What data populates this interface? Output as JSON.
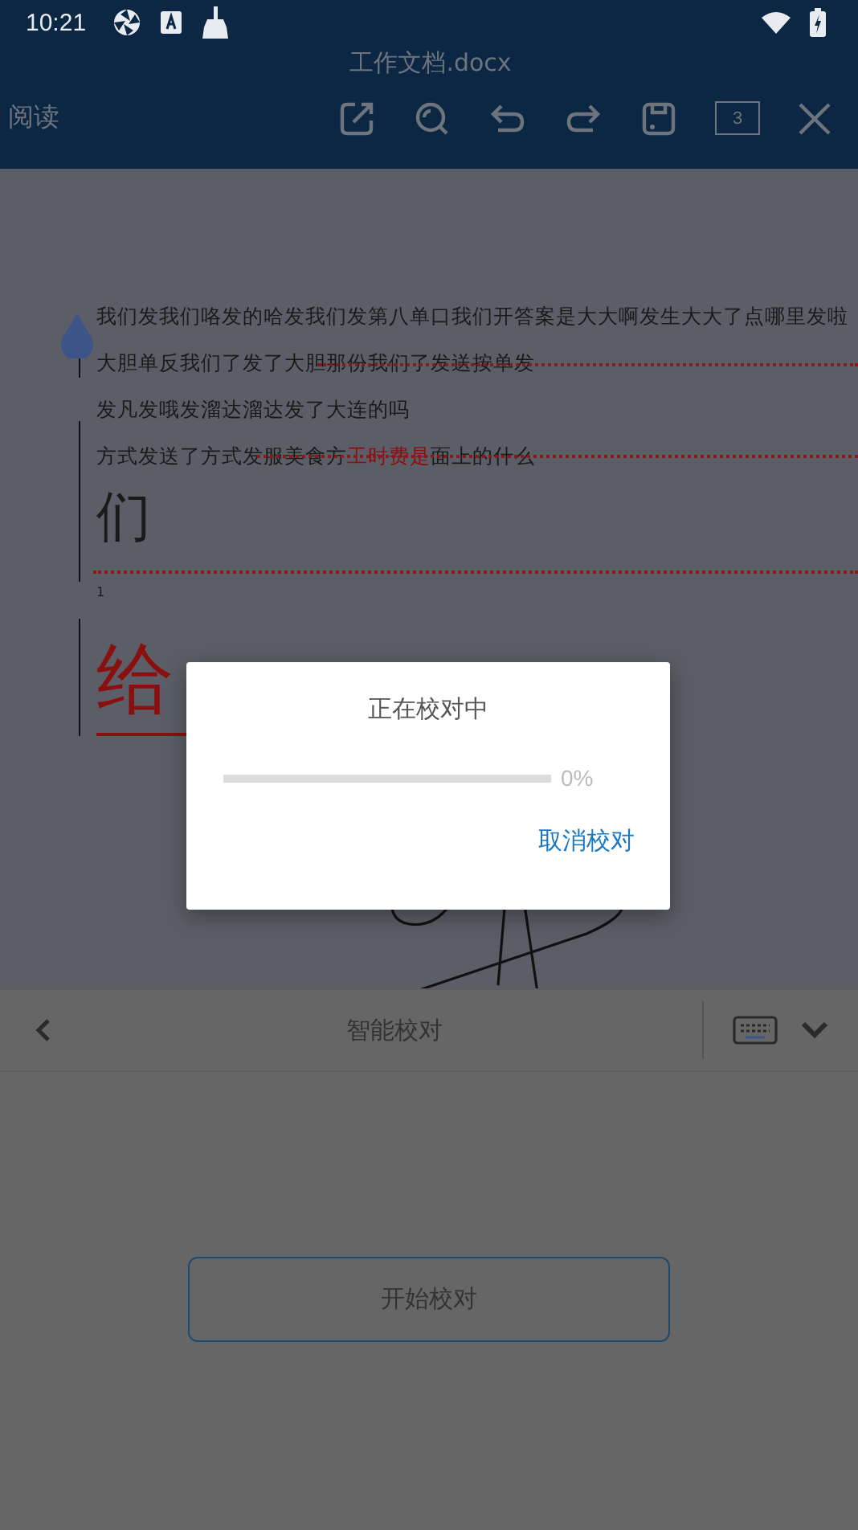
{
  "status_bar": {
    "time": "10:21"
  },
  "title_bar": {
    "title": "工作文档.docx"
  },
  "toolbar": {
    "mode": "阅读",
    "page_count": "3"
  },
  "document": {
    "paragraphs": [
      {
        "kind": "text",
        "segments": [
          {
            "text": "我们发我们咯发的哈发我们发第八单口我们开答案是大大啊发生大大了点哪里发啦",
            "error": false
          }
        ]
      },
      {
        "kind": "text",
        "segments": [
          {
            "text": "大胆单反我们了发了大胆那份我们了发送按单发",
            "error": false
          }
        ]
      },
      {
        "kind": "text",
        "segments": [
          {
            "text": "发凡发哦发溜达溜达发了大连的吗",
            "error": false
          }
        ]
      },
      {
        "kind": "text",
        "segments": [
          {
            "text": "方式发送了方式发服美食方",
            "error": false
          },
          {
            "text": "工时费是",
            "error": true
          },
          {
            "text": "面上的什么",
            "error": false
          }
        ]
      },
      {
        "kind": "large",
        "segments": [
          {
            "text": "们",
            "error": false
          }
        ]
      },
      {
        "kind": "note",
        "segments": [
          {
            "text": "1",
            "error": false
          }
        ]
      },
      {
        "kind": "heading",
        "segments": [
          {
            "text": "给",
            "error": true
          }
        ]
      }
    ]
  },
  "dialog": {
    "title": "正在校对中",
    "level": 0,
    "percent": "0%",
    "cancel": "取消校对"
  },
  "proofread_bar": {
    "title": "智能校对"
  },
  "start_button": "开始校对"
}
